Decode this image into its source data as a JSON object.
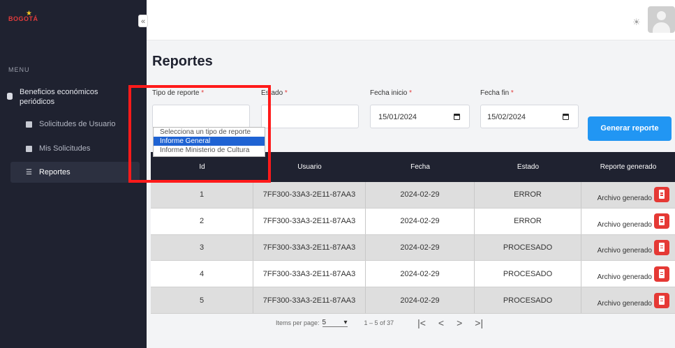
{
  "sidebar": {
    "logo_text": "BOGOTÁ",
    "menu_label": "MENU",
    "group_label_line1": "Beneficios económicos",
    "group_label_line2": "periódicos",
    "items": [
      {
        "label": "Solicitudes de Usuario"
      },
      {
        "label": "Mis Solicitudes"
      },
      {
        "label": "Reportes"
      }
    ]
  },
  "topbar": {
    "collapse_symbol": "«",
    "theme_icon": "sun-icon"
  },
  "page": {
    "title": "Reportes"
  },
  "form": {
    "tipo_label": "Tipo de reporte",
    "estado_label": "Estado",
    "fecha_inicio_label": "Fecha inicio",
    "fecha_fin_label": "Fecha fin",
    "required_mark": "*",
    "fecha_inicio_value": "15/01/2024",
    "fecha_fin_value": "15/02/2024",
    "tipo_options": [
      "Selecciona un tipo de reporte",
      "Informe General",
      "Informe Ministerio de Cultura"
    ],
    "tipo_highlighted": "Informe General",
    "generate_label": "Generar reporte"
  },
  "table": {
    "headers": [
      "Id",
      "Usuario",
      "Fecha",
      "Estado",
      "Reporte generado"
    ],
    "rows": [
      {
        "id": "1",
        "usuario": "7FF300-33A3-2E11-87AA3",
        "fecha": "2024-02-29",
        "estado": "ERROR",
        "reporte": "Archivo generado"
      },
      {
        "id": "2",
        "usuario": "7FF300-33A3-2E11-87AA3",
        "fecha": "2024-02-29",
        "estado": "ERROR",
        "reporte": "Archivo generado"
      },
      {
        "id": "3",
        "usuario": "7FF300-33A3-2E11-87AA3",
        "fecha": "2024-02-29",
        "estado": "PROCESADO",
        "reporte": "Archivo generado"
      },
      {
        "id": "4",
        "usuario": "7FF300-33A3-2E11-87AA3",
        "fecha": "2024-02-29",
        "estado": "PROCESADO",
        "reporte": "Archivo generado"
      },
      {
        "id": "5",
        "usuario": "7FF300-33A3-2E11-87AA3",
        "fecha": "2024-02-29",
        "estado": "PROCESADO",
        "reporte": "Archivo generado"
      }
    ]
  },
  "paginator": {
    "items_label": "Items per page:",
    "page_size": "5",
    "range": "1 – 5 of 37",
    "first": "|<",
    "prev": "<",
    "next": ">",
    "last": ">|"
  },
  "colors": {
    "sidebar_bg": "#1f2230",
    "accent": "#2196f3",
    "danger": "#e53935",
    "highlight": "#ff1a1a"
  }
}
